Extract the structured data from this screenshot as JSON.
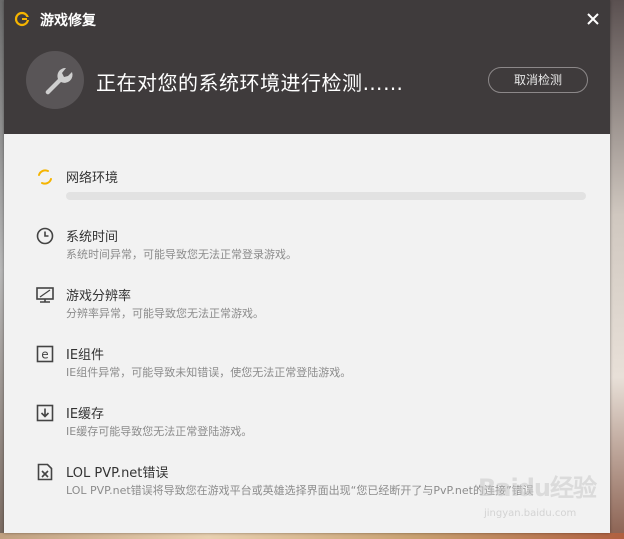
{
  "window": {
    "title": "游戏修复"
  },
  "header": {
    "status": "正在对您的系统环境进行检测……",
    "cancel_label": "取消检测"
  },
  "checks": [
    {
      "icon": "spinner-icon",
      "label": "网络环境",
      "desc": "",
      "progress": 0.0
    },
    {
      "icon": "clock-icon",
      "label": "系统时间",
      "desc": "系统时间异常，可能导致您无法正常登录游戏。"
    },
    {
      "icon": "monitor-icon",
      "label": "游戏分辨率",
      "desc": "分辨率异常，可能导致您无法正常游戏。"
    },
    {
      "icon": "ie-icon",
      "label": "IE组件",
      "desc": "IE组件异常，可能导致未知错误，使您无法正常登陆游戏。"
    },
    {
      "icon": "download-icon",
      "label": "IE缓存",
      "desc": "IE缓存可能导致您无法正常登陆游戏。"
    },
    {
      "icon": "file-error-icon",
      "label": "LOL PVP.net错误",
      "desc": "LOL PVP.net错误将导致您在游戏平台或英雄选择界面出现“您已经断开了与PvP.net的连接”错误"
    }
  ],
  "watermark": {
    "text": "Baidu经验",
    "sub": "jingyan.baidu.com"
  },
  "colors": {
    "header_bg": "#3f3b3c",
    "accent": "#f5b400",
    "panel_bg": "#f2f2f2"
  }
}
